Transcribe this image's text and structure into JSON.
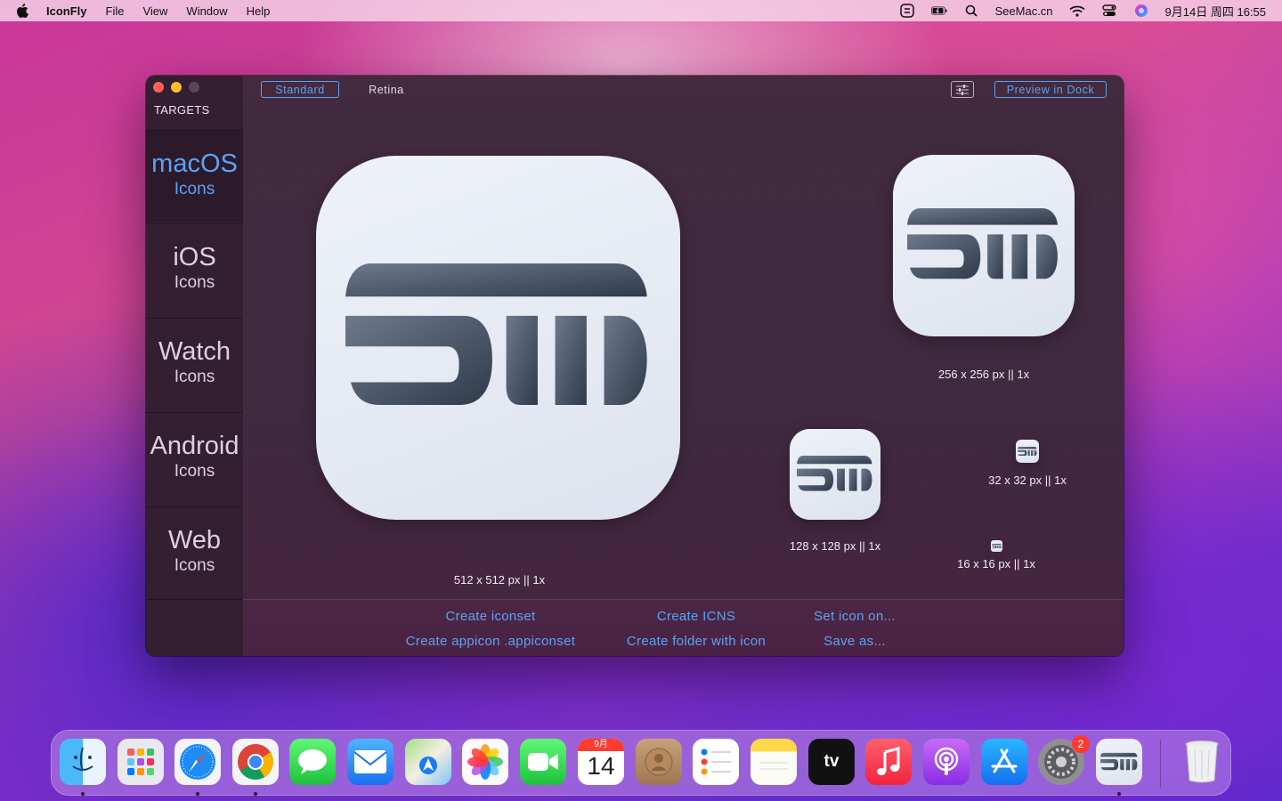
{
  "menubar": {
    "app_name": "IconFly",
    "menus": [
      "File",
      "View",
      "Window",
      "Help"
    ],
    "status_text": "SeeMac.cn",
    "datetime": "9月14日 周四  16:55"
  },
  "window": {
    "sidebar": {
      "header": "TARGETS",
      "targets": [
        {
          "main": "macOS",
          "sub": "Icons",
          "active": true
        },
        {
          "main": "iOS",
          "sub": "Icons",
          "active": false
        },
        {
          "main": "Watch",
          "sub": "Icons",
          "active": false
        },
        {
          "main": "Android",
          "sub": "Icons",
          "active": false
        },
        {
          "main": "Web",
          "sub": "Icons",
          "active": false
        }
      ]
    },
    "toolbar": {
      "standard_label": "Standard",
      "retina_label": "Retina",
      "preview_label": "Preview in Dock",
      "selected": "Standard"
    },
    "previews": [
      {
        "size": "512 x 512 px",
        "scale": "1x",
        "label": "512 x 512 px  ||  1x"
      },
      {
        "size": "256 x 256 px",
        "scale": "1x",
        "label": "256 x 256 px  ||  1x"
      },
      {
        "size": "128 x 128 px",
        "scale": "1x",
        "label": "128 x 128 px  ||  1x"
      },
      {
        "size": "32 x 32 px",
        "scale": "1x",
        "label": "32 x 32 px  ||  1x"
      },
      {
        "size": "16 x 16 px",
        "scale": "1x",
        "label": "16 x 16 px  ||  1x"
      }
    ],
    "actions": {
      "create_iconset": "Create iconset",
      "create_icns": "Create ICNS",
      "set_icon_on": "Set icon on...",
      "create_appicon": "Create appicon .appiconset",
      "create_folder": "Create folder with icon",
      "save_as": "Save as..."
    }
  },
  "dock": {
    "items": [
      "finder-icon",
      "launchpad-icon",
      "safari-icon",
      "chrome-icon",
      "messages-icon",
      "mail-icon",
      "maps-icon",
      "photos-icon",
      "facetime-icon",
      "calendar-icon",
      "contacts-icon",
      "reminders-icon",
      "notes-icon",
      "apple-tv-icon",
      "music-icon",
      "podcasts-icon",
      "app-store-icon",
      "system-preferences-icon",
      "iconfly-icon",
      "trash-icon"
    ],
    "calendar": {
      "month": "9月",
      "day": "14"
    },
    "tv_label": "tv",
    "system_prefs_badge": "2"
  },
  "colors": {
    "accent": "#5aa3f5",
    "window_bg": "#432a3e",
    "sidebar_bg": "#331f31"
  }
}
